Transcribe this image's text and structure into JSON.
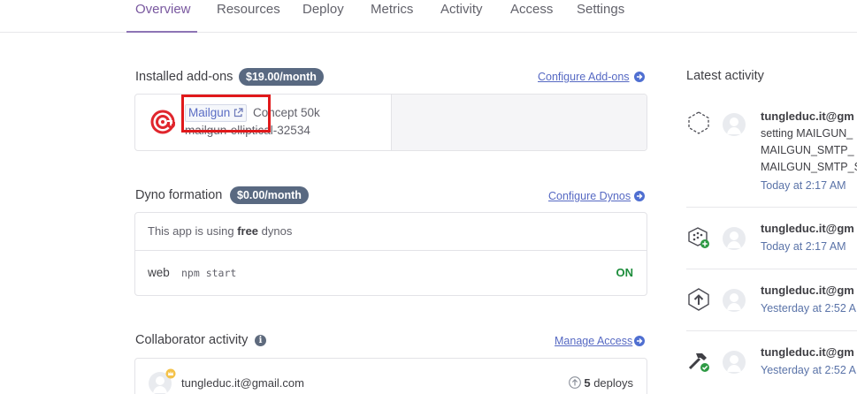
{
  "tabs": [
    {
      "label": "Overview",
      "active": true
    },
    {
      "label": "Resources",
      "active": false
    },
    {
      "label": "Deploy",
      "active": false
    },
    {
      "label": "Metrics",
      "active": false
    },
    {
      "label": "Activity",
      "active": false
    },
    {
      "label": "Access",
      "active": false
    },
    {
      "label": "Settings",
      "active": false
    }
  ],
  "addons": {
    "title": "Installed add-ons",
    "price": "$19.00/month",
    "configure_link": "Configure Add-ons",
    "items": [
      {
        "service": "Mailgun",
        "plan": "Concept 50k",
        "name": "mailgun-elliptical-32534",
        "icon": "mailgun-logo-icon"
      }
    ]
  },
  "dynos": {
    "title": "Dyno formation",
    "price": "$0.00/month",
    "configure_link": "Configure Dynos",
    "notice_prefix": "This app is using",
    "notice_bold": "free",
    "notice_suffix": "dynos",
    "process": {
      "type": "web",
      "command": "npm start",
      "status": "ON"
    }
  },
  "collaborators": {
    "title": "Collaborator activity",
    "manage_link": "Manage Access",
    "items": [
      {
        "email": "tungleduc.it@gmail.com",
        "deploys_count": "5",
        "deploys_label": "deploys"
      }
    ]
  },
  "activity": {
    "title": "Latest activity",
    "items": [
      {
        "icon": "config-vars-icon",
        "user": "tungleduc.it@gm",
        "lines": [
          "setting MAILGUN_",
          "MAILGUN_SMTP_",
          "MAILGUN_SMTP_S"
        ],
        "time": "Today at 2:17 AM"
      },
      {
        "icon": "addon-added-icon",
        "user": "tungleduc.it@gm",
        "lines": [],
        "time": "Today at 2:17 AM"
      },
      {
        "icon": "deploy-icon",
        "user": "tungleduc.it@gm",
        "lines": [],
        "time": "Yesterday at 2:52 A"
      },
      {
        "icon": "build-success-icon",
        "user": "tungleduc.it@gm",
        "lines": [],
        "time": "Yesterday at 2:52 A"
      }
    ]
  },
  "colors": {
    "accent": "#79589f",
    "link": "#5669c3",
    "pill": "#596981",
    "on": "#1d8d3c",
    "highlight": "#e0191b"
  }
}
